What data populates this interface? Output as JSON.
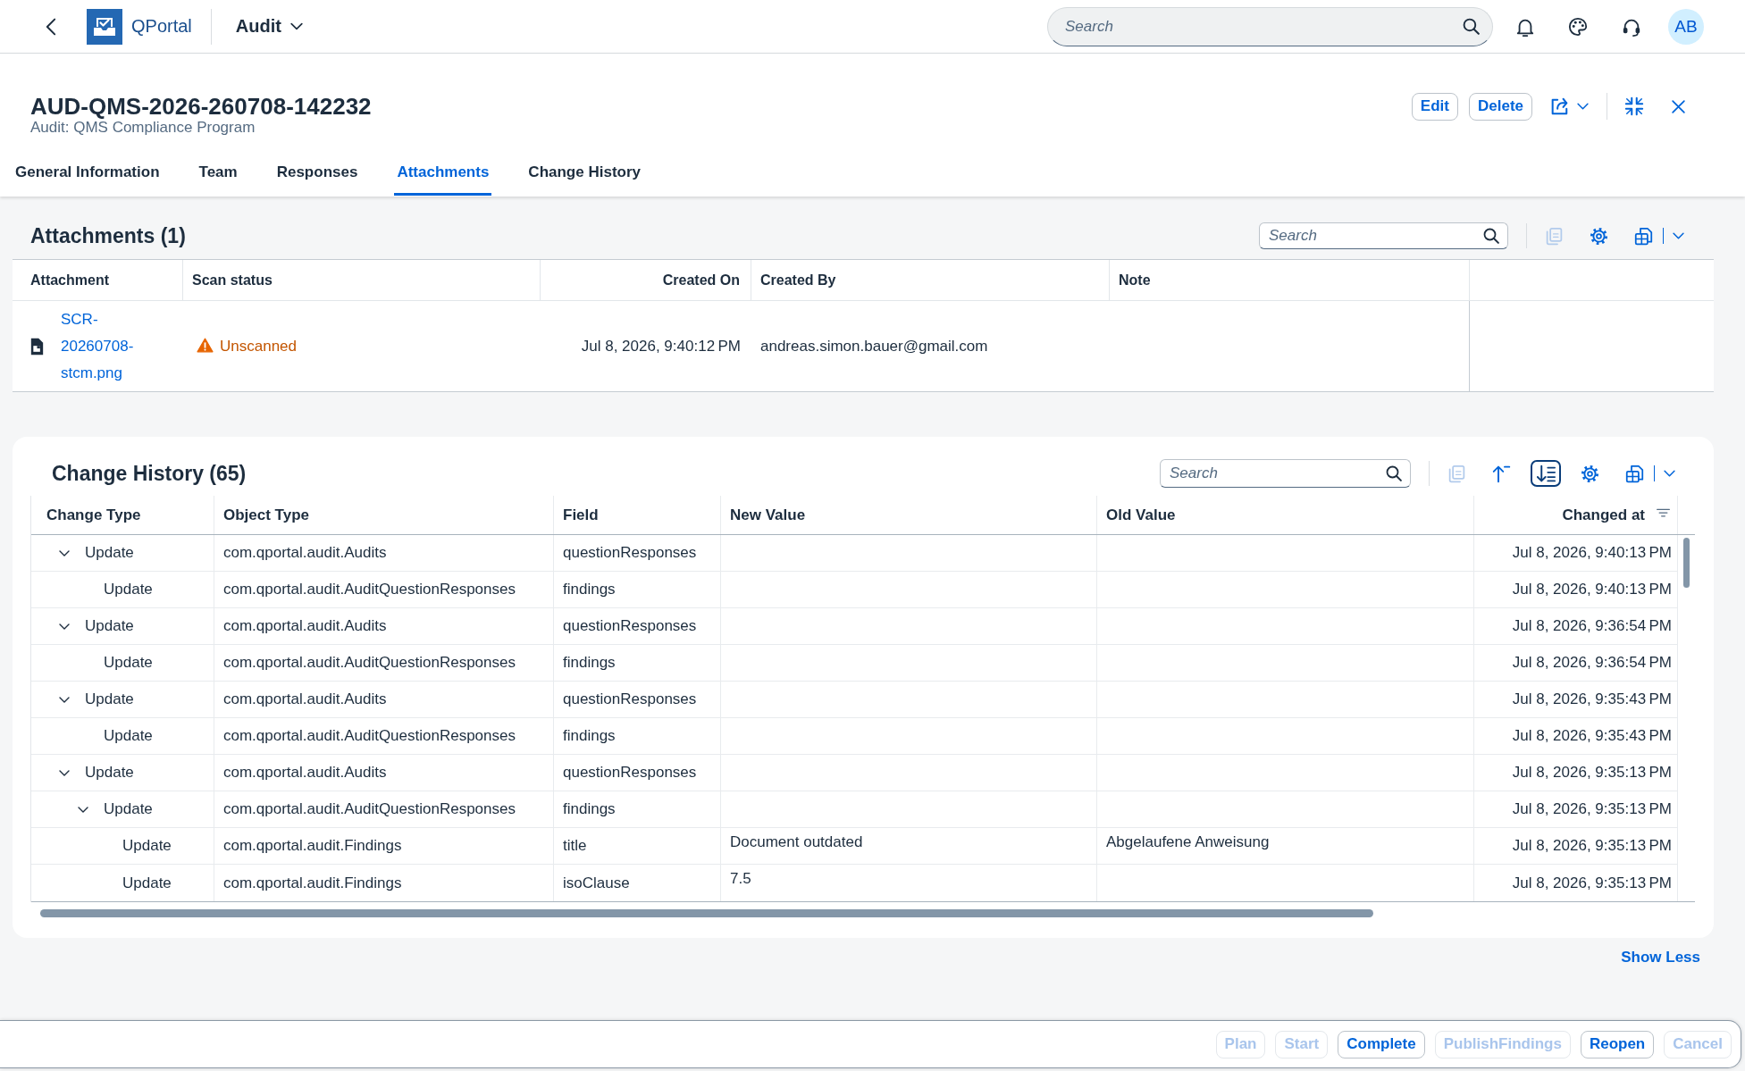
{
  "shell_bar": {
    "logo_text": "QPortal",
    "app_menu": "Audit",
    "search": {
      "placeholder": "Search"
    },
    "avatar": "AB"
  },
  "object_header": {
    "title": "AUD-QMS-2026-260708-142232",
    "subtitle": "Audit: QMS Compliance Program",
    "actions": [
      "Edit",
      "Delete"
    ]
  },
  "tabs": [
    {
      "label": "General Information",
      "selected": false
    },
    {
      "label": "Team",
      "selected": false
    },
    {
      "label": "Responses",
      "selected": false
    },
    {
      "label": "Attachments",
      "selected": true
    },
    {
      "label": "Change History",
      "selected": false
    }
  ],
  "attachments": {
    "title": "Attachments (1)",
    "search": {
      "placeholder": "Search"
    },
    "toolbar": {
      "copy": {
        "disabled": true
      }
    },
    "columns": [
      {
        "label": "Attachment",
        "kind": "text"
      },
      {
        "label": "Scan status",
        "kind": "text"
      },
      {
        "label": "Created On",
        "kind": "date"
      },
      {
        "label": "Created By",
        "kind": "text"
      },
      {
        "label": "Note",
        "kind": "text"
      }
    ],
    "rows": [
      {
        "attachment": "SCR-20260708-stcm.png",
        "scan_status": {
          "kind": "warning",
          "label": "Unscanned"
        },
        "created_on": "Jul 8, 2026, 9:40:12 PM",
        "created_by": "andreas.simon.bauer@gmail.com"
      }
    ]
  },
  "change_history": {
    "title": "Change History (65)",
    "search": {
      "placeholder": "Search"
    },
    "toolbar": {
      "copy": {
        "disabled": true
      },
      "tree_toggle": {
        "pressed": true
      }
    },
    "columns": [
      {
        "label": "Change Type",
        "kind": "text",
        "sorted": false
      },
      {
        "label": "Object Type",
        "kind": "text",
        "sorted": false
      },
      {
        "label": "Field",
        "kind": "text",
        "sorted": false
      },
      {
        "label": "New Value",
        "kind": "value",
        "sorted": false
      },
      {
        "label": "Old Value",
        "kind": "value",
        "sorted": false
      },
      {
        "label": "Changed at",
        "kind": "date",
        "sorted": true
      }
    ],
    "rows": [
      {
        "change_type": "Update",
        "object_type": "com.qportal.audit.Audits",
        "field": "questionResponses",
        "changed_at": "Jul 8, 2026, 9:40:13 PM",
        "expanded": true,
        "children": [
          {
            "change_type": "Update",
            "object_type": "com.qportal.audit.AuditQuestionResponses",
            "field": "findings",
            "changed_at": "Jul 8, 2026, 9:40:13 PM"
          }
        ]
      },
      {
        "change_type": "Update",
        "object_type": "com.qportal.audit.Audits",
        "field": "questionResponses",
        "changed_at": "Jul 8, 2026, 9:36:54 PM",
        "expanded": true,
        "children": [
          {
            "change_type": "Update",
            "object_type": "com.qportal.audit.AuditQuestionResponses",
            "field": "findings",
            "changed_at": "Jul 8, 2026, 9:36:54 PM"
          }
        ]
      },
      {
        "change_type": "Update",
        "object_type": "com.qportal.audit.Audits",
        "field": "questionResponses",
        "changed_at": "Jul 8, 2026, 9:35:43 PM",
        "expanded": true,
        "children": [
          {
            "change_type": "Update",
            "object_type": "com.qportal.audit.AuditQuestionResponses",
            "field": "findings",
            "changed_at": "Jul 8, 2026, 9:35:43 PM"
          }
        ]
      },
      {
        "change_type": "Update",
        "object_type": "com.qportal.audit.Audits",
        "field": "questionResponses",
        "changed_at": "Jul 8, 2026, 9:35:13 PM",
        "expanded": true,
        "children": [
          {
            "change_type": "Update",
            "object_type": "com.qportal.audit.AuditQuestionResponses",
            "field": "findings",
            "changed_at": "Jul 8, 2026, 9:35:13 PM",
            "expanded": true,
            "children": [
              {
                "change_type": "Update",
                "object_type": "com.qportal.audit.Findings",
                "field": "title",
                "new_value": "Document outdated",
                "old_value": "Abgelaufene Anweisung",
                "changed_at": "Jul 8, 2026, 9:35:13 PM"
              },
              {
                "change_type": "Update",
                "object_type": "com.qportal.audit.Findings",
                "field": "isoClause",
                "new_value": "7.5",
                "changed_at": "Jul 8, 2026, 9:35:13 PM"
              }
            ]
          }
        ]
      }
    ]
  },
  "show_less_link": "Show Less",
  "footer_actions": [
    {
      "label": "Plan",
      "disabled": true
    },
    {
      "label": "Start",
      "disabled": true
    },
    {
      "label": "Complete",
      "disabled": false
    },
    {
      "label": "PublishFindings",
      "disabled": true
    },
    {
      "label": "Reopen",
      "disabled": false
    },
    {
      "label": "Cancel",
      "disabled": true
    }
  ]
}
